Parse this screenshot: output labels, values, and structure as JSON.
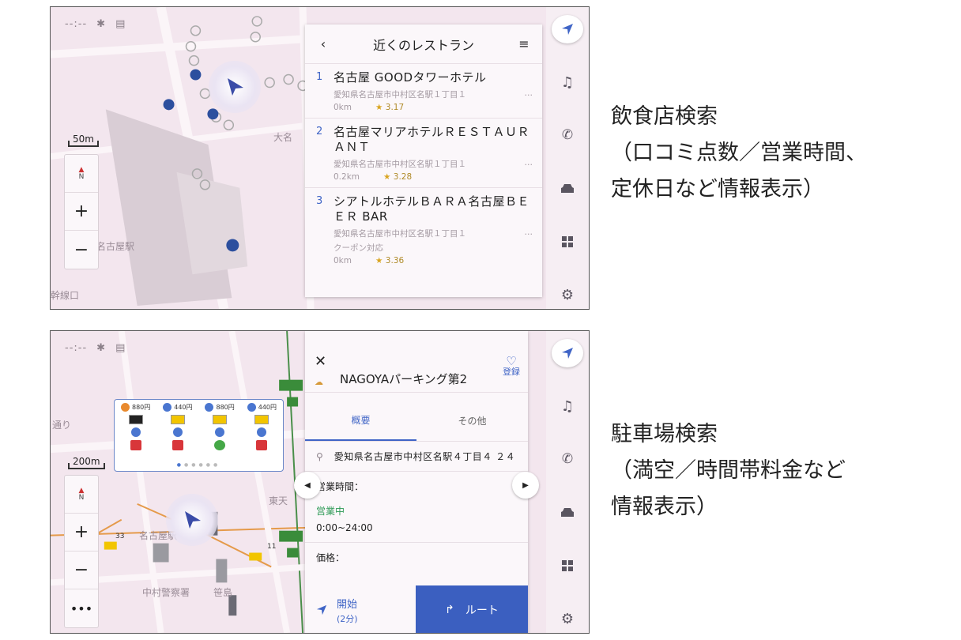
{
  "top_screen": {
    "status": {
      "time": "--:--"
    },
    "scale": "50m",
    "map_labels": {
      "station": "名古屋駅",
      "area": "大名",
      "line": "幹線口"
    },
    "list": {
      "title": "近くのレストラン",
      "items": [
        {
          "num": "1",
          "name": "名古屋 GOODタワーホテル",
          "address": "愛知県名古屋市中村区名駅１丁目１",
          "extra": "",
          "distance": "0km",
          "rating": "3.17"
        },
        {
          "num": "2",
          "name": "名古屋マリアホテルＲＥＳＴＡＵＲＡＮＴ",
          "address": "愛知県名古屋市中村区名駅１丁目１",
          "extra": "",
          "distance": "0.2km",
          "rating": "3.28"
        },
        {
          "num": "3",
          "name": "シアトルホテルＢＡＲＡ名古屋ＢＥＥＲ BAR",
          "address": "愛知県名古屋市中村区名駅１丁目１",
          "extra": "クーポン対応",
          "distance": "0km",
          "rating": "3.36"
        }
      ],
      "ellipsis": "…"
    }
  },
  "bottom_screen": {
    "status": {
      "time": "--:--"
    },
    "scale": "200m",
    "map_labels": {
      "station": "名古屋駅",
      "police": "中村警察署",
      "east": "東天",
      "sasa": "笹島",
      "dori": "通り",
      "num33": "33",
      "num11": "11"
    },
    "popup": {
      "prices": [
        "880円",
        "440円",
        "880円",
        "440円"
      ]
    },
    "detail": {
      "name": "NAGOYAパーキング第2",
      "fav_label": "登録",
      "tabs": [
        "概要",
        "その他"
      ],
      "address": "愛知県名古屋市中村区名駅４丁目４ ２４",
      "hours_label": "営業時間：",
      "status": "営業中",
      "hours": "0:00~24:00",
      "price_label": "価格：",
      "start_label": "開始",
      "start_sub": "(2分)",
      "route_label": "ルート"
    }
  },
  "captions": {
    "top": [
      "飲食店検索",
      "（口コミ点数／営業時間、",
      "定休日など情報表示）"
    ],
    "bottom": [
      "駐車場検索",
      "（満空／時間帯料金など",
      "情報表示）"
    ]
  },
  "colors": {
    "accent": "#3f64c6",
    "route_button": "#3b5fc0",
    "open_status": "#2d9a55",
    "map_bg": "#f3e6ee"
  }
}
